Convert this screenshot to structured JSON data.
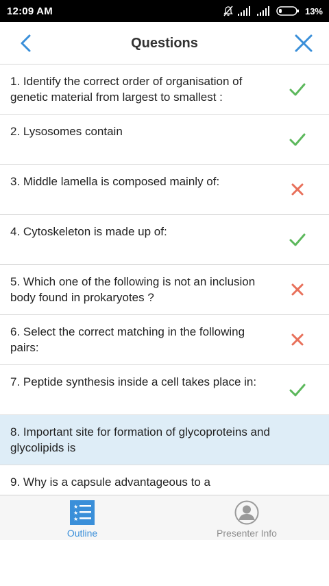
{
  "status_bar": {
    "time": "12:09 AM",
    "battery_percent": "13%",
    "icons": [
      "bell-off-icon",
      "signal-icon",
      "signal-icon",
      "battery-icon"
    ]
  },
  "header": {
    "title": "Questions",
    "back_icon": "chevron-left-icon",
    "close_icon": "close-icon"
  },
  "questions": [
    {
      "text": "1. Identify the correct order of organisation of genetic material from largest to smallest :",
      "status": "correct"
    },
    {
      "text": "2. Lysosomes contain",
      "status": "correct"
    },
    {
      "text": "3. Middle lamella is composed mainly of:",
      "status": "incorrect"
    },
    {
      "text": "4. Cytoskeleton is made up of:",
      "status": "correct"
    },
    {
      "text": "5. Which one of the following is not an inclusion body found in prokaryotes ?",
      "status": "incorrect"
    },
    {
      "text": "6. Select the correct matching in the following pairs:",
      "status": "incorrect"
    },
    {
      "text": "7. Peptide synthesis inside a cell takes place in:",
      "status": "correct"
    },
    {
      "text": "8. Important site for formation of glycoproteins and glycolipids is",
      "status": "none",
      "highlighted": true
    },
    {
      "text": "9. Why is a capsule advantageous to a",
      "status": "none"
    }
  ],
  "bottom_nav": {
    "outline_label": "Outline",
    "presenter_label": "Presenter Info"
  },
  "colors": {
    "accent": "#3a8fd9",
    "correct": "#5cb85c",
    "incorrect": "#e8705a",
    "highlight": "#deedf7"
  }
}
